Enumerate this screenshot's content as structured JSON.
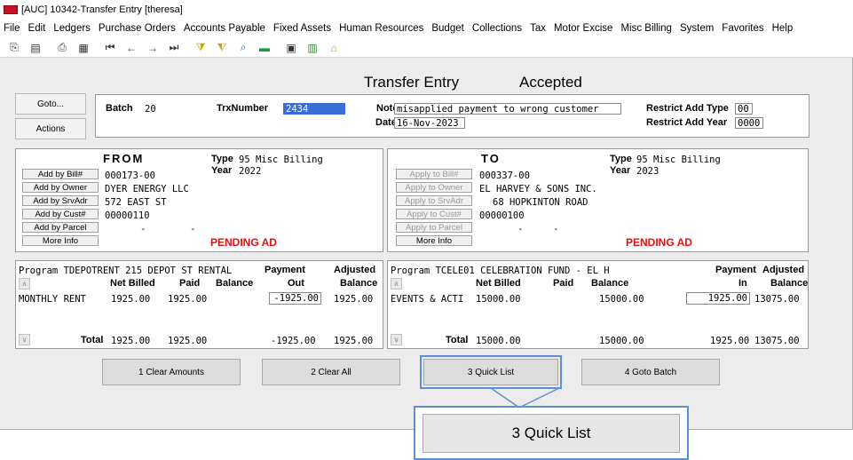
{
  "window": {
    "title": "[AUC] 10342-Transfer Entry [theresa]"
  },
  "menu": [
    "File",
    "Edit",
    "Ledgers",
    "Purchase Orders",
    "Accounts Payable",
    "Fixed Assets",
    "Human Resources",
    "Budget",
    "Collections",
    "Tax",
    "Motor Excise",
    "Misc Billing",
    "System",
    "Favorites",
    "Help"
  ],
  "toolbar_icons": [
    "copy-icon",
    "paste-icon",
    "print-icon",
    "print-preview-icon",
    "first-record-icon",
    "previous-record-icon",
    "next-record-icon",
    "last-record-icon",
    "filter-icon",
    "clear-filter-icon",
    "search-icon",
    "export-icon",
    "properties-icon",
    "chart-icon",
    "organization-icon"
  ],
  "form": {
    "title": "Transfer Entry",
    "status": "Accepted"
  },
  "left_buttons": {
    "goto": "Goto...",
    "actions": "Actions"
  },
  "header": {
    "batch_label": "Batch",
    "batch_value": "20",
    "trx_label": "TrxNumber",
    "trx_value": "2434",
    "note_label": "Note",
    "note_value": "misapplied payment to wrong customer",
    "date_label": "Date",
    "date_value": "16-Nov-2023",
    "restrict_type_label": "Restrict Add Type",
    "restrict_type_value": "00",
    "restrict_year_label": "Restrict Add Year",
    "restrict_year_value": "0000"
  },
  "from": {
    "title": "FROM",
    "type_label": "Type",
    "type_value": "95 Misc Billing",
    "year_label": "Year",
    "year_value": "2022",
    "lines": [
      "000173-00",
      "DYER ENERGY LLC",
      "572 EAST ST",
      "00000110",
      "-",
      "-"
    ],
    "buttons": [
      "Add by Bill#",
      "Add by Owner",
      "Add by SrvAdr",
      "Add by Cust#",
      "Add by Parcel",
      "More Info"
    ],
    "pending": "PENDING AD"
  },
  "to": {
    "title": "TO",
    "type_label": "Type",
    "type_value": "95 Misc Billing",
    "year_label": "Year",
    "year_value": "2023",
    "lines": [
      "000337-00",
      "EL HARVEY & SONS INC.",
      "68 HOPKINTON ROAD",
      "00000100",
      "-",
      "-"
    ],
    "buttons": [
      "Apply to Bill#",
      "Apply to Owner",
      "Apply to SrvAdr",
      "Apply to Cust#",
      "Apply to Parcel",
      "More Info"
    ],
    "pending": "PENDING AD"
  },
  "from_grid": {
    "program": "Program TDEPOTRENT 215 DEPOT ST RENTAL",
    "headers": [
      "Net Billed",
      "Paid",
      "Balance",
      "Payment",
      "Out",
      "Adjusted",
      "Balance"
    ],
    "row": {
      "label": "MONTHLY RENT",
      "net_billed": "1925.00",
      "paid": "1925.00",
      "payment": "-1925.00",
      "adjusted": "1925.00"
    },
    "total": {
      "label": "Total",
      "net_billed": "1925.00",
      "paid": "1925.00",
      "payment": "-1925.00",
      "adjusted": "1925.00"
    }
  },
  "to_grid": {
    "program": "Program TCELE01   CELEBRATION FUND - EL H",
    "headers": [
      "Net Billed",
      "Paid",
      "Balance",
      "Payment",
      "In",
      "Adjusted",
      "Balance"
    ],
    "row": {
      "label": "EVENTS & ACTI",
      "net_billed": "15000.00",
      "balance": "15000.00",
      "payment": "1925.00",
      "adjusted": "13075.00"
    },
    "total": {
      "label": "Total",
      "net_billed": "15000.00",
      "balance": "15000.00",
      "payment": "1925.00",
      "adjusted": "13075.00"
    }
  },
  "bottom_buttons": [
    "1 Clear Amounts",
    "2 Clear All",
    "3 Quick List",
    "4 Goto Batch"
  ],
  "callout": {
    "label": "3 Quick List"
  },
  "colors": {
    "pending": "#e01010",
    "highlight": "#3a6fd8",
    "callout_border": "#5b8fd6"
  }
}
